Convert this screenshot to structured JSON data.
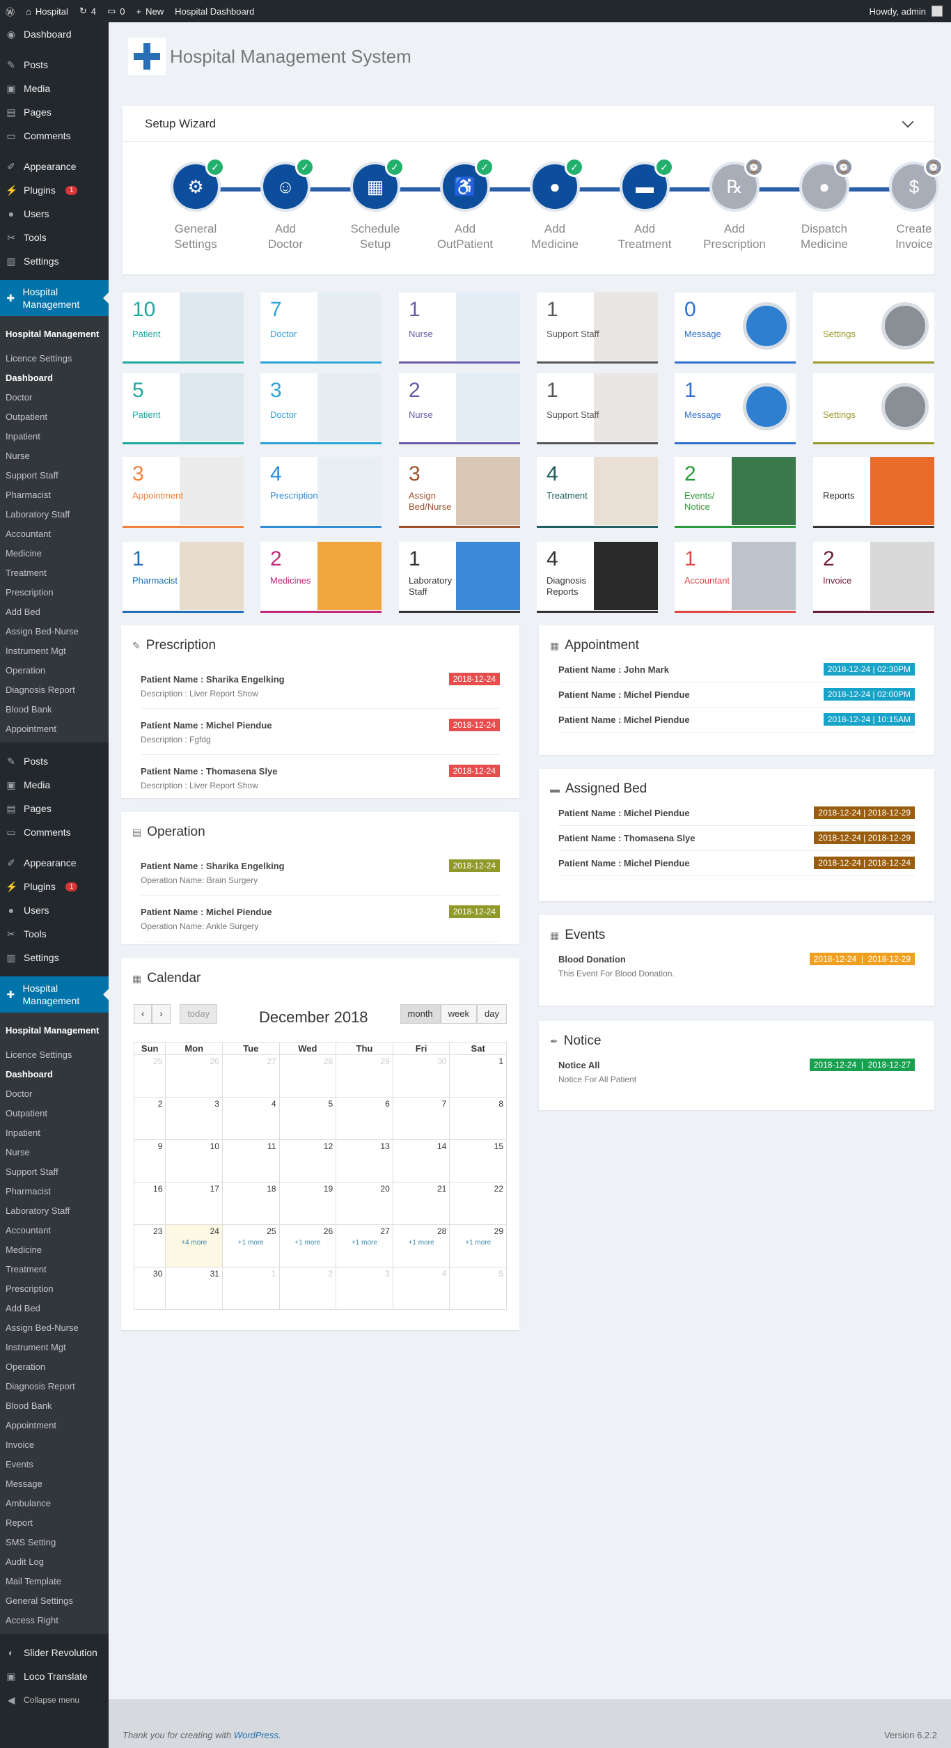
{
  "adminbar": {
    "site": "Hospital",
    "updates": "4",
    "comments": "0",
    "new": "New",
    "dashboard": "Hospital Dashboard",
    "howdy": "Howdy, admin"
  },
  "sidebar": {
    "top": [
      {
        "label": "Dashboard",
        "icon": "dashboard-icon"
      },
      {
        "label": "Posts",
        "icon": "pin-icon"
      },
      {
        "label": "Media",
        "icon": "media-icon"
      },
      {
        "label": "Pages",
        "icon": "page-icon"
      },
      {
        "label": "Comments",
        "icon": "comment-icon"
      },
      {
        "label": "Appearance",
        "icon": "brush-icon"
      },
      {
        "label": "Plugins",
        "icon": "plugin-icon",
        "badge": "1"
      },
      {
        "label": "Users",
        "icon": "user-icon"
      },
      {
        "label": "Tools",
        "icon": "wrench-icon"
      },
      {
        "label": "Settings",
        "icon": "settings-icon"
      }
    ],
    "active": "Hospital Management",
    "sub1": [
      "Hospital Management",
      "Licence Settings",
      "Dashboard",
      "Doctor",
      "Outpatient",
      "Inpatient",
      "Nurse",
      "Support Staff",
      "Pharmacist",
      "Laboratory Staff",
      "Accountant",
      "Medicine",
      "Treatment",
      "Prescription",
      "Add Bed",
      "Assign Bed-Nurse",
      "Instrument Mgt",
      "Operation",
      "Diagnosis Report",
      "Blood Bank",
      "Appointment"
    ],
    "mid": [
      {
        "label": "Posts"
      },
      {
        "label": "Media"
      },
      {
        "label": "Pages"
      },
      {
        "label": "Comments"
      },
      {
        "label": "Appearance"
      },
      {
        "label": "Plugins",
        "badge": "1"
      },
      {
        "label": "Users"
      },
      {
        "label": "Tools"
      },
      {
        "label": "Settings"
      }
    ],
    "sub2": [
      "Hospital Management",
      "Licence Settings",
      "Dashboard",
      "Doctor",
      "Outpatient",
      "Inpatient",
      "Nurse",
      "Support Staff",
      "Pharmacist",
      "Laboratory Staff",
      "Accountant",
      "Medicine",
      "Treatment",
      "Prescription",
      "Add Bed",
      "Assign Bed-Nurse",
      "Instrument Mgt",
      "Operation",
      "Diagnosis Report",
      "Blood Bank",
      "Appointment",
      "Invoice",
      "Events",
      "Message",
      "Ambulance",
      "Report",
      "SMS Setting",
      "Audit Log",
      "Mail Template",
      "General Settings",
      "Access Right"
    ],
    "bottom": [
      "Slider Revolution",
      "Loco Translate",
      "Collapse menu"
    ]
  },
  "header": {
    "title": "Hospital Management System"
  },
  "wizard": {
    "title": "Setup Wizard",
    "steps": [
      {
        "l1": "General",
        "l2": "Settings",
        "done": true,
        "icon": "gear-icon",
        "glyph": "⚙"
      },
      {
        "l1": "Add",
        "l2": "Doctor",
        "done": true,
        "icon": "doctor-icon",
        "glyph": "☺"
      },
      {
        "l1": "Schedule",
        "l2": "Setup",
        "done": true,
        "icon": "calendar-icon",
        "glyph": "▦"
      },
      {
        "l1": "Add",
        "l2": "OutPatient",
        "done": true,
        "icon": "walking-icon",
        "glyph": "♿"
      },
      {
        "l1": "Add",
        "l2": "Medicine",
        "done": true,
        "icon": "pill-icon",
        "glyph": "●"
      },
      {
        "l1": "Add",
        "l2": "Treatment",
        "done": true,
        "icon": "bed-icon",
        "glyph": "▬"
      },
      {
        "l1": "Add",
        "l2": "Prescription",
        "done": false,
        "icon": "prescription-icon",
        "glyph": "℞"
      },
      {
        "l1": "Dispatch",
        "l2": "Medicine",
        "done": false,
        "icon": "pill-icon",
        "glyph": "●"
      },
      {
        "l1": "Create",
        "l2": "Invoice",
        "done": false,
        "icon": "invoice-icon",
        "glyph": "$"
      }
    ]
  },
  "cards": [
    {
      "num": "10",
      "label": "Patient",
      "color": "#1ea9a0"
    },
    {
      "num": "7",
      "label": "Doctor",
      "color": "#29a3d6"
    },
    {
      "num": "1",
      "label": "Nurse",
      "color": "#6a5aa8"
    },
    {
      "num": "1",
      "label": "Support Staff",
      "color": "#555555"
    },
    {
      "num": "0",
      "label": "Message",
      "color": "#2f6fd0"
    },
    {
      "num": "",
      "label": "Settings",
      "color": "#9a9a2a"
    },
    {
      "num": "5",
      "label": "Patient",
      "color": "#1ea9a0"
    },
    {
      "num": "3",
      "label": "Doctor",
      "color": "#29a3d6"
    },
    {
      "num": "2",
      "label": "Nurse",
      "color": "#6a5aa8"
    },
    {
      "num": "1",
      "label": "Support Staff",
      "color": "#555555"
    },
    {
      "num": "1",
      "label": "Message",
      "color": "#2f6fd0"
    },
    {
      "num": "",
      "label": "Settings",
      "color": "#9a9a2a"
    },
    {
      "num": "3",
      "label": "Appointment",
      "color": "#f0823c"
    },
    {
      "num": "4",
      "label": "Prescription",
      "color": "#2f8ad8"
    },
    {
      "num": "3",
      "label": "Assign Bed/Nurse",
      "color": "#a0522d"
    },
    {
      "num": "4",
      "label": "Treatment",
      "color": "#1e5e5e"
    },
    {
      "num": "2",
      "label": "Events/ Notice",
      "color": "#2b9a3a"
    },
    {
      "num": "",
      "label": "Reports",
      "color": "#333333"
    },
    {
      "num": "1",
      "label": "Pharmacist",
      "color": "#1f6fb8"
    },
    {
      "num": "2",
      "label": "Medicines",
      "color": "#c0287a"
    },
    {
      "num": "1",
      "label": "Laboratory Staff",
      "color": "#333333"
    },
    {
      "num": "4",
      "label": "Diagnosis Reports",
      "color": "#333333"
    },
    {
      "num": "1",
      "label": "Accountant",
      "color": "#e04848"
    },
    {
      "num": "2",
      "label": "Invoice",
      "color": "#6a1d3a"
    }
  ],
  "prescription": {
    "title": "Prescription",
    "items": [
      {
        "patient": "Patient Name : Sharika Engelking",
        "desc": "Description : Liver Report Show",
        "date": "2018-12-24"
      },
      {
        "patient": "Patient Name : Michel Piendue",
        "desc": "Description : Fgfdg",
        "date": "2018-12-24"
      },
      {
        "patient": "Patient Name : Thomasena Slye",
        "desc": "Description : Liver Report Show",
        "date": "2018-12-24"
      }
    ]
  },
  "operation": {
    "title": "Operation",
    "items": [
      {
        "patient": "Patient Name : Sharika Engelking",
        "desc": "Operation Name: Brain Surgery",
        "date": "2018-12-24"
      },
      {
        "patient": "Patient Name : Michel Piendue",
        "desc": "Operation Name: Ankle Surgery",
        "date": "2018-12-24"
      }
    ]
  },
  "appointment": {
    "title": "Appointment",
    "items": [
      {
        "patient": "Patient Name : John Mark",
        "date": "2018-12-24",
        "time": "02:30PM"
      },
      {
        "patient": "Patient Name : Michel Piendue",
        "date": "2018-12-24",
        "time": "02:00PM"
      },
      {
        "patient": "Patient Name : Michel Piendue",
        "date": "2018-12-24",
        "time": "10:15AM"
      }
    ]
  },
  "assigned_bed": {
    "title": "Assigned Bed",
    "items": [
      {
        "patient": "Patient Name : Michel Piendue",
        "from": "2018-12-24",
        "to": "2018-12-29"
      },
      {
        "patient": "Patient Name : Thomasena Slye",
        "from": "2018-12-24",
        "to": "2018-12-29"
      },
      {
        "patient": "Patient Name : Michel Piendue",
        "from": "2018-12-24",
        "to": "2018-12-24"
      }
    ]
  },
  "events": {
    "title": "Events",
    "name": "Blood Donation",
    "desc": "This Event For Blood Donation.",
    "from": "2018-12-24",
    "to": "2018-12-29"
  },
  "notice": {
    "title": "Notice",
    "name": "Notice All",
    "desc": "Notice For All Patient",
    "from": "2018-12-24",
    "to": "2018-12-27"
  },
  "calendar": {
    "title": "Calendar",
    "month": "December 2018",
    "today": "today",
    "views": [
      "month",
      "week",
      "day"
    ],
    "days": [
      "Sun",
      "Mon",
      "Tue",
      "Wed",
      "Thu",
      "Fri",
      "Sat"
    ],
    "weeks": [
      [
        [
          "25",
          1
        ],
        [
          "26",
          1
        ],
        [
          "27",
          1
        ],
        [
          "28",
          1
        ],
        [
          "29",
          1
        ],
        [
          "30",
          1
        ],
        [
          "1",
          0
        ]
      ],
      [
        [
          "2",
          0
        ],
        [
          "3",
          0
        ],
        [
          "4",
          0
        ],
        [
          "5",
          0
        ],
        [
          "6",
          0
        ],
        [
          "7",
          0
        ],
        [
          "8",
          0
        ]
      ],
      [
        [
          "9",
          0
        ],
        [
          "10",
          0
        ],
        [
          "11",
          0
        ],
        [
          "12",
          0
        ],
        [
          "13",
          0
        ],
        [
          "14",
          0
        ],
        [
          "15",
          0
        ]
      ],
      [
        [
          "16",
          0
        ],
        [
          "17",
          0
        ],
        [
          "18",
          0
        ],
        [
          "19",
          0
        ],
        [
          "20",
          0
        ],
        [
          "21",
          0
        ],
        [
          "22",
          0
        ]
      ],
      [
        [
          "23",
          0
        ],
        [
          "24",
          0
        ],
        [
          "25",
          0
        ],
        [
          "26",
          0
        ],
        [
          "27",
          0
        ],
        [
          "28",
          0
        ],
        [
          "29",
          0
        ]
      ],
      [
        [
          "30",
          0
        ],
        [
          "31",
          0
        ],
        [
          "1",
          1
        ],
        [
          "2",
          1
        ],
        [
          "3",
          1
        ],
        [
          "4",
          1
        ],
        [
          "5",
          1
        ]
      ]
    ],
    "more": {
      "24": "+4 more",
      "25": "+1 more",
      "26": "+1 more",
      "27": "+1 more",
      "28": "+1 more",
      "29": "+1 more"
    }
  },
  "footer": {
    "text": "Thank you for creating with ",
    "link": "WordPress.",
    "version": "Version 6.2.2"
  },
  "colors": {
    "red": "#e84d4d",
    "olive": "#8f9a2a",
    "cyan": "#17a2c8",
    "brown": "#9a5d0e",
    "orange": "#f0a020",
    "green": "#18a050"
  }
}
